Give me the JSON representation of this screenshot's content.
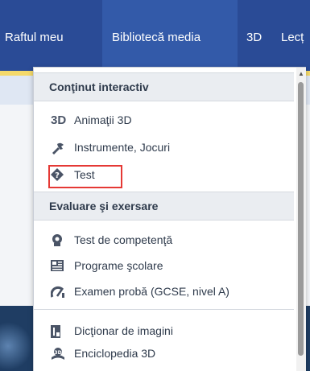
{
  "nav": {
    "items": [
      {
        "label": "Raftul meu"
      },
      {
        "label": "Bibliotecă media"
      },
      {
        "label": "3D"
      },
      {
        "label": "Lecț"
      }
    ]
  },
  "dropdown": {
    "sections": [
      {
        "title": "Conţinut interactiv",
        "items": [
          {
            "label": "Animaţii 3D",
            "icon": "3d-badge-icon",
            "icon_text": "3D"
          },
          {
            "label": "Instrumente, Jocuri",
            "icon": "tools-icon"
          },
          {
            "label": "Test",
            "icon": "quiz-icon",
            "highlighted": true
          }
        ]
      },
      {
        "title": "Evaluare şi exersare",
        "items": [
          {
            "label": "Test de competenţă",
            "icon": "competency-icon"
          },
          {
            "label": "Programe şcolare",
            "icon": "curriculum-icon"
          },
          {
            "label": "Examen probă (GCSE, nivel A)",
            "icon": "exam-icon"
          }
        ]
      },
      {
        "title": "",
        "items": [
          {
            "label": "Dicţionar de imagini",
            "icon": "dictionary-icon"
          },
          {
            "label": "Enciclopedia 3D",
            "icon": "encyclopedia-icon"
          }
        ]
      }
    ]
  },
  "colors": {
    "nav_bg": "#2a4b96",
    "highlight": "#e53935",
    "accent_yellow": "#f4d96a"
  }
}
